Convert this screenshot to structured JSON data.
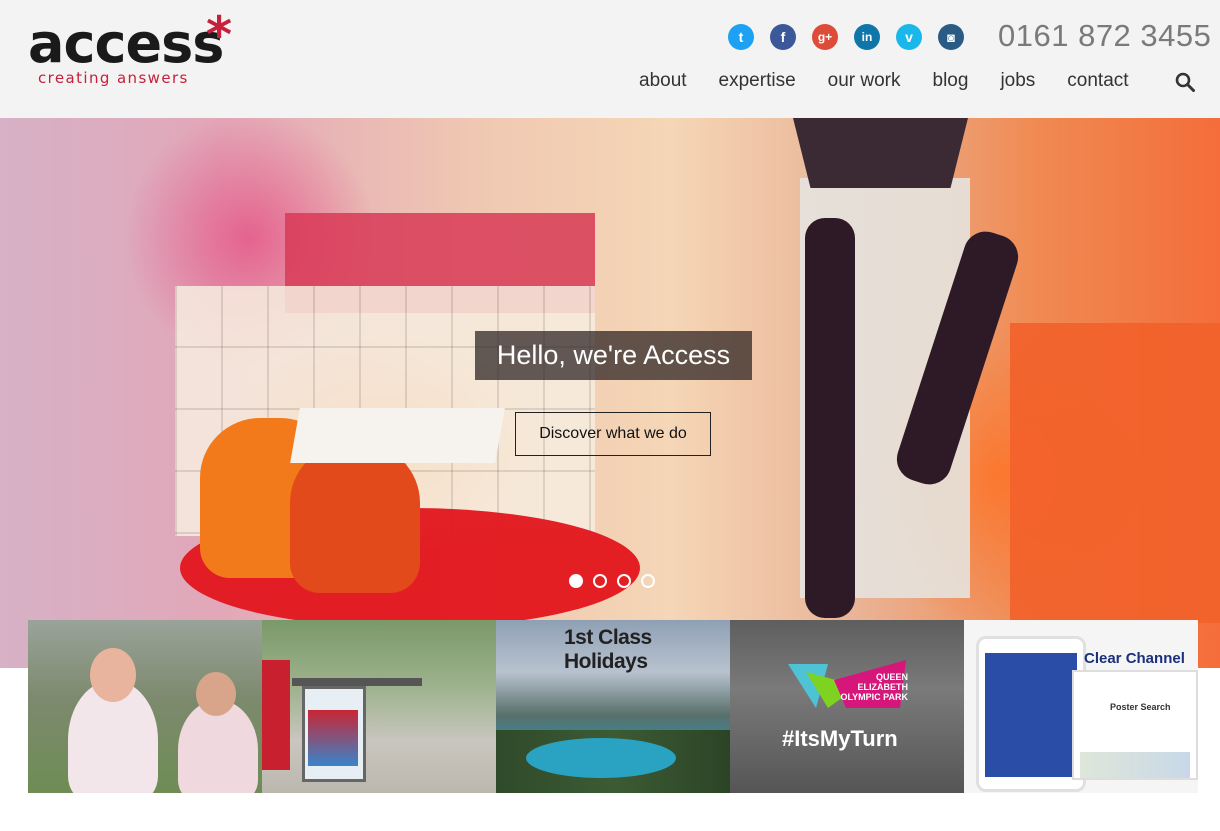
{
  "brand": {
    "logo_word": "access",
    "logo_star": "*",
    "tagline": "creating answers",
    "accent_color": "#c6203b"
  },
  "header": {
    "phone": "0161 872 3455",
    "social": [
      {
        "name": "twitter-icon",
        "glyph": "t",
        "color": "#1da1f2"
      },
      {
        "name": "facebook-icon",
        "glyph": "f",
        "color": "#3b5998"
      },
      {
        "name": "googleplus-icon",
        "glyph": "g+",
        "color": "#dd4b39"
      },
      {
        "name": "linkedin-icon",
        "glyph": "in",
        "color": "#0e76a8"
      },
      {
        "name": "vimeo-icon",
        "glyph": "v",
        "color": "#1ab7ea"
      },
      {
        "name": "instagram-icon",
        "glyph": "◙",
        "color": "#2a5b84"
      }
    ],
    "nav": [
      "about",
      "expertise",
      "our work",
      "blog",
      "jobs",
      "contact"
    ]
  },
  "hero": {
    "title": "Hello, we're Access",
    "button": "Discover what we do",
    "slides": 4,
    "active_slide": 1
  },
  "thumbnails": [
    {
      "name": "colour-run",
      "caption": ""
    },
    {
      "name": "bus-shelter-ad",
      "caption": ""
    },
    {
      "name": "1st-class-holidays",
      "caption": "1st Class Holidays"
    },
    {
      "name": "queen-elizabeth-olympic-park",
      "caption": "#ItsMyTurn",
      "logo_text": "QUEEN ELIZABETH OLYMPIC PARK"
    },
    {
      "name": "clear-channel",
      "caption": "Clear Channel",
      "sub": "Poster Search"
    }
  ]
}
